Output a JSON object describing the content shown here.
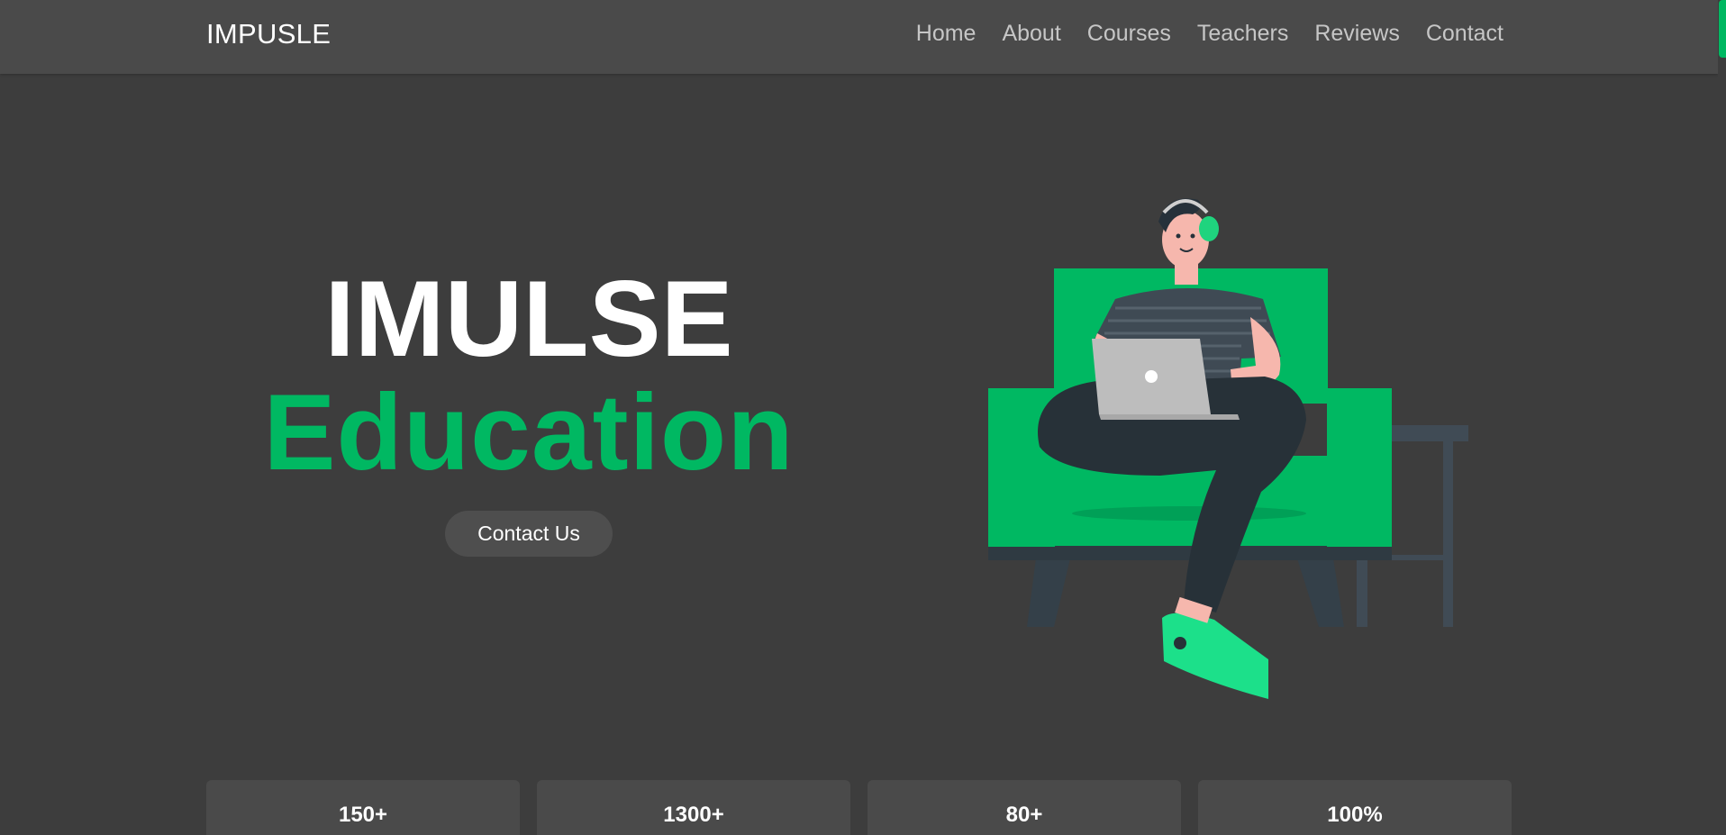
{
  "header": {
    "logo": "IMPUSLE",
    "nav": [
      "Home",
      "About",
      "Courses",
      "Teachers",
      "Reviews",
      "Contact"
    ]
  },
  "hero": {
    "title": "IMULSE",
    "subtitle": "Education",
    "cta_label": "Contact Us"
  },
  "stats": [
    "150+",
    "1300+",
    "80+",
    "100%"
  ],
  "colors": {
    "background": "#3d3d3d",
    "header": "#4a4a4a",
    "accent": "#00b862",
    "text": "#ffffff",
    "nav_text": "#c6c6c6"
  }
}
